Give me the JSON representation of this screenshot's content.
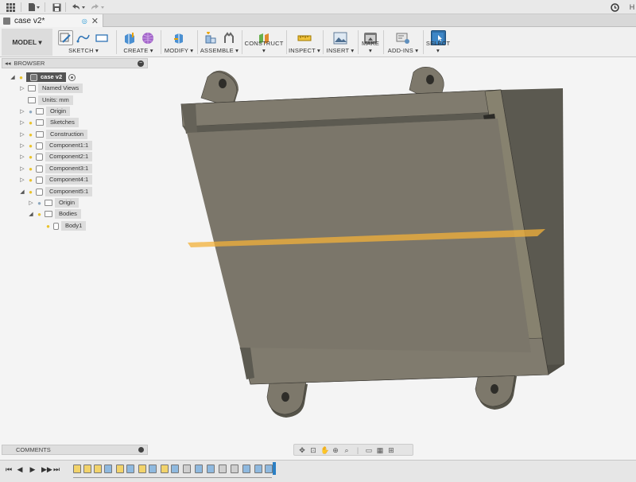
{
  "app": {
    "grid_icon": "app-grid-icon",
    "file_icon": "file-icon",
    "save_icon": "save-icon",
    "undo_icon": "undo-icon",
    "redo_icon": "redo-icon",
    "clock_icon": "clock-icon",
    "user_initial": "H"
  },
  "document": {
    "tab_title": "case v2*"
  },
  "toolbar": {
    "mode": "MODEL",
    "groups": [
      {
        "label": "SKETCH"
      },
      {
        "label": "CREATE"
      },
      {
        "label": "MODIFY"
      },
      {
        "label": "ASSEMBLE"
      },
      {
        "label": "CONSTRUCT"
      },
      {
        "label": "INSPECT"
      },
      {
        "label": "INSERT"
      },
      {
        "label": "MAKE"
      },
      {
        "label": "ADD-INS"
      },
      {
        "label": "SELECT"
      }
    ]
  },
  "browser": {
    "title": "BROWSER",
    "items": [
      {
        "label": "case v2"
      },
      {
        "label": "Named Views"
      },
      {
        "label": "Units: mm"
      },
      {
        "label": "Origin"
      },
      {
        "label": "Sketches"
      },
      {
        "label": "Construction"
      },
      {
        "label": "Component1:1"
      },
      {
        "label": "Component2:1"
      },
      {
        "label": "Component3:1"
      },
      {
        "label": "Component4:1"
      },
      {
        "label": "Component5:1"
      },
      {
        "label": "Origin"
      },
      {
        "label": "Bodies"
      },
      {
        "label": "Body1"
      }
    ]
  },
  "comments": {
    "title": "COMMENTS"
  },
  "colors": {
    "model_face": "#7d786b",
    "model_side": "#555349",
    "plane": "#f3b23a",
    "accent": "#2b7fc4"
  }
}
